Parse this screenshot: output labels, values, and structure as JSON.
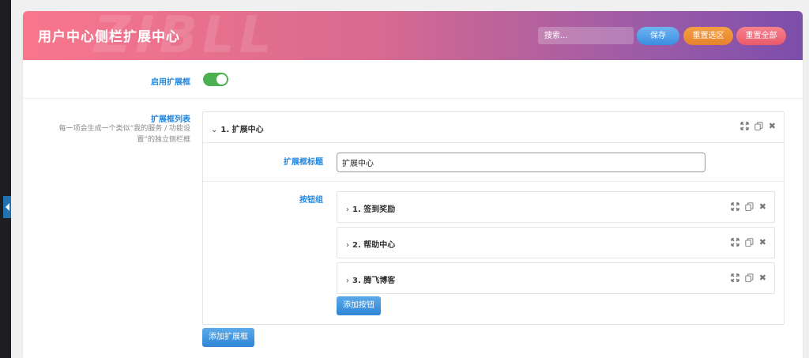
{
  "header": {
    "title": "用户中心侧栏扩展中心",
    "watermark": "ZIBLL",
    "search_placeholder": "搜索...",
    "save_label": "保存",
    "reset_selection_label": "重置选区",
    "reset_all_label": "重置全部"
  },
  "enable_field": {
    "label": "启用扩展框",
    "enabled": true
  },
  "list_field": {
    "label": "扩展框列表",
    "description_line1": "每一项会生成一个类似“我的服务 / 功能设",
    "description_line2": "置”的独立侧栏框",
    "add_label": "添加扩展框"
  },
  "extension": {
    "header_title": "1. 扩展中心",
    "title_label": "扩展框标题",
    "title_value": "扩展中心",
    "buttons_label": "按钮组",
    "add_button_label": "添加按钮",
    "buttons": [
      {
        "title": "1. 签到奖励"
      },
      {
        "title": "2. 帮助中心"
      },
      {
        "title": "3. 腾飞博客"
      }
    ]
  },
  "icons": [
    "expand-icon",
    "copy-icon",
    "close-icon",
    "chevron-down-icon",
    "chevron-right-icon"
  ],
  "colors": {
    "accent": "#1e88e5",
    "toggle_on": "#4caf50",
    "save": "#3b8de0",
    "reset_selection": "#e5832b",
    "reset_all": "#ea5a6b"
  }
}
